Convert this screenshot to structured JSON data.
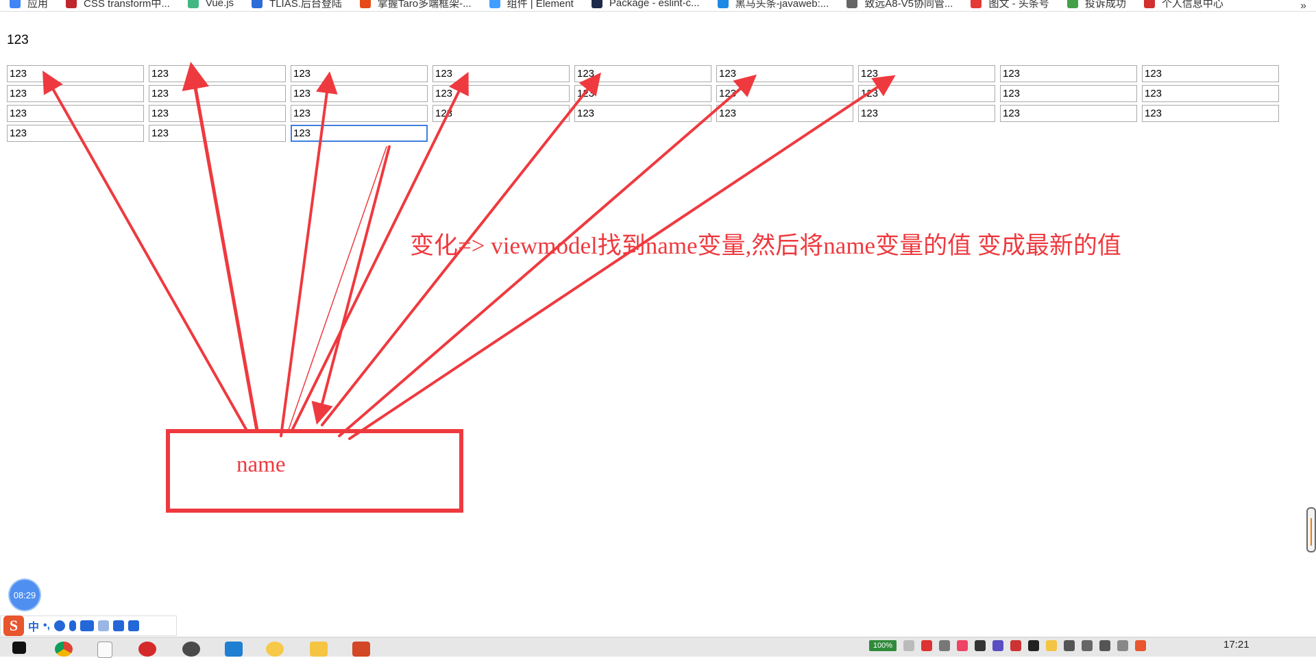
{
  "bookmarks": [
    {
      "label": "应用",
      "icon": "apps-grid-icon",
      "color": "#4285f4"
    },
    {
      "label": "CSS transform中...",
      "icon": "csdn-icon",
      "color": "#c0262d"
    },
    {
      "label": "Vue.js",
      "icon": "vue-icon",
      "color": "#41b883"
    },
    {
      "label": "TLIAS.后台登陆",
      "icon": "tlias-icon",
      "color": "#2b6cd8"
    },
    {
      "label": "掌握Taro多端框架-...",
      "icon": "flame-icon",
      "color": "#e64a19"
    },
    {
      "label": "组件 | Element",
      "icon": "element-icon",
      "color": "#409eff"
    },
    {
      "label": "Package - eslint-c...",
      "icon": "npm-n-icon",
      "color": "#1e2a4a"
    },
    {
      "label": "黑马头条-javaweb:...",
      "icon": "globe-icon",
      "color": "#1e88e5"
    },
    {
      "label": "致远A8-V5协同管...",
      "icon": "seeyon-icon",
      "color": "#666666"
    },
    {
      "label": "图文 - 头条号",
      "icon": "toutiao-icon",
      "color": "#e53935"
    },
    {
      "label": "投诉成功",
      "icon": "leaf-icon",
      "color": "#43a047"
    },
    {
      "label": "个人信息中心",
      "icon": "emblem-icon",
      "color": "#d32f2f"
    }
  ],
  "bookmarks_more": "»",
  "page": {
    "heading": "123",
    "inputs": [
      [
        "123",
        "123",
        "123",
        "123",
        "123",
        "123",
        "123",
        "123",
        "123"
      ],
      [
        "123",
        "123",
        "123",
        "123",
        "123",
        "123",
        "123",
        "123",
        "123"
      ],
      [
        "123",
        "123",
        "123",
        "123",
        "123",
        "123",
        "123",
        "123",
        "123"
      ],
      [
        "123",
        "123",
        "123"
      ]
    ]
  },
  "annotation": {
    "text": "变化=> viewmodel找到name变量,然后将name变量的值 变成最新的值",
    "box_label": "name",
    "color": "#ee3a3f"
  },
  "clock_bubble": "08:29",
  "ime": {
    "logo": "S",
    "mode": "中",
    "punct": "•,",
    "icons": [
      "emoji-icon",
      "microphone-icon",
      "keyboard-icon",
      "user-icon",
      "skin-icon",
      "toolbox-icon"
    ]
  },
  "taskbar": {
    "apps": [
      "windows-start-icon",
      "chrome-icon",
      "typora-icon",
      "feather-app-icon",
      "settings-gear-icon",
      "vscode-icon",
      "weather-app-icon",
      "file-explorer-icon",
      "powerpoint-icon"
    ],
    "battery": "100%",
    "time": "17:21"
  }
}
